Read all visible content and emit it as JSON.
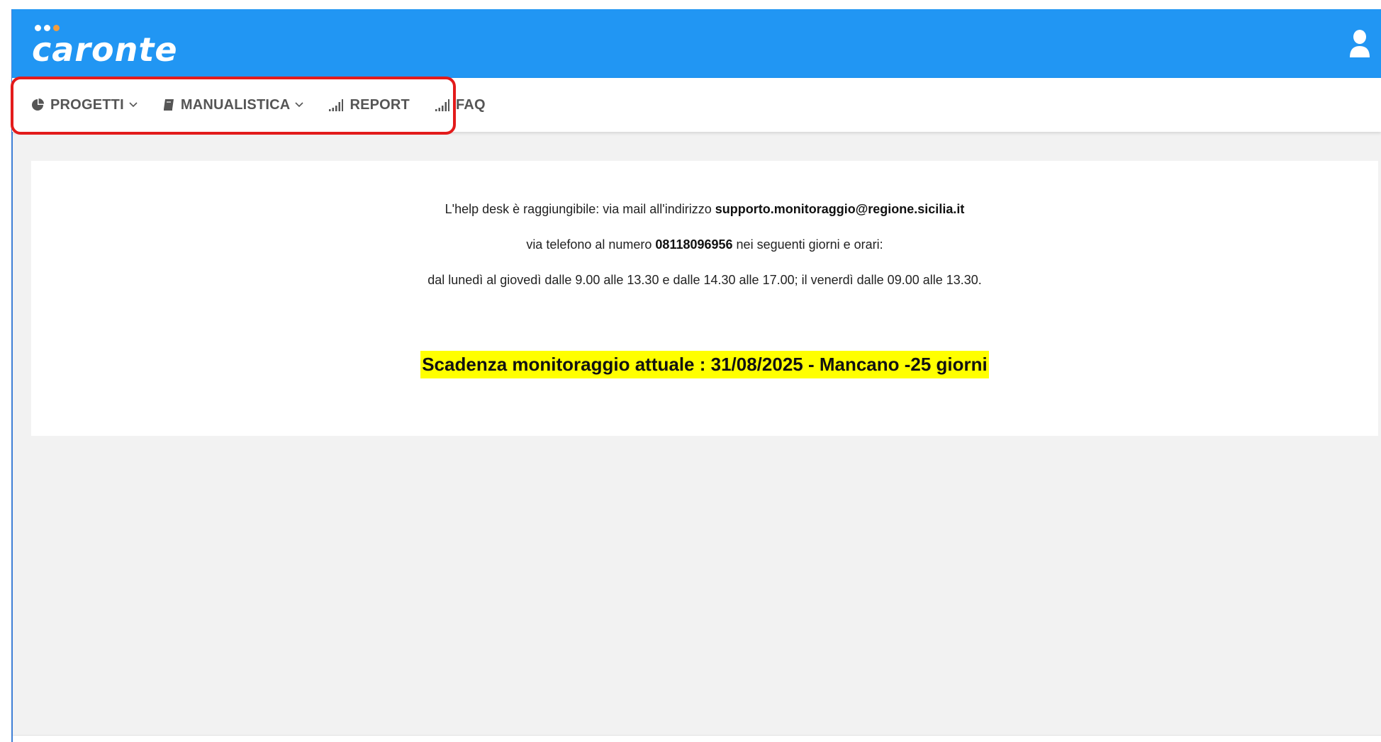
{
  "header": {
    "logo_text": "caronte",
    "user_icon": "user-icon",
    "color": "#2196f3"
  },
  "nav": {
    "items": [
      {
        "label": "PROGETTI",
        "icon": "pie-chart-icon",
        "dropdown": true
      },
      {
        "label": "MANUALISTICA",
        "icon": "book-icon",
        "dropdown": true
      },
      {
        "label": "REPORT",
        "icon": "signal-bars-icon",
        "dropdown": false
      },
      {
        "label": "FAQ",
        "icon": "signal-bars-icon",
        "dropdown": false
      }
    ],
    "highlight_color": "#e31b1b"
  },
  "help": {
    "line1_prefix": "L'help desk è raggiungibile: via mail all'indirizzo ",
    "email": "supporto.monitoraggio@regione.sicilia.it",
    "line2_prefix": "via telefono al numero ",
    "phone": "08118096956",
    "line2_suffix": " nei seguenti giorni e orari:",
    "line3": "dal lunedì al giovedì dalle 9.00 alle 13.30 e dalle 14.30 alle 17.00; il venerdì dalle 09.00 alle 13.30."
  },
  "deadline": {
    "text": "Scadenza monitoraggio attuale : 31/08/2025 - Mancano -25 giorni",
    "highlight_color": "#ffff00"
  }
}
